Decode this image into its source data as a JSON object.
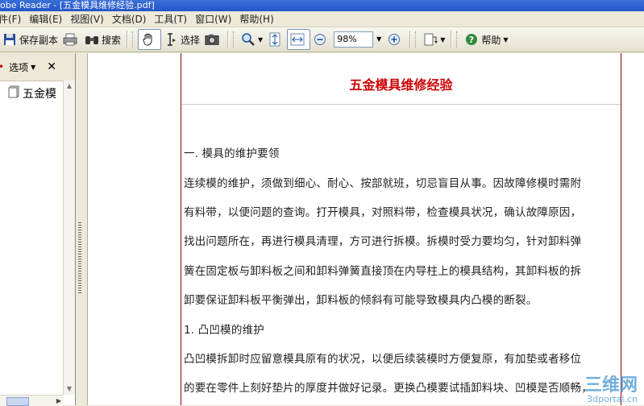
{
  "window": {
    "title": "obe Reader - [五金模具维修经验.pdf]"
  },
  "menu": [
    "件(F)",
    "编辑(E)",
    "视图(V)",
    "文档(D)",
    "工具(T)",
    "窗口(W)",
    "帮助(H)"
  ],
  "toolbar": {
    "save_copy": "保存副本",
    "search": "搜索",
    "select": "选择",
    "zoom": "98%",
    "help": "帮助"
  },
  "left_panel": {
    "options": "选项",
    "bookmark": "五金模"
  },
  "document": {
    "title": "五金模具维修经验",
    "lines": [
      "一.    模具的维护要领",
      "连续模的维护，须做到细心、耐心、按部就班，切忌盲目从事。因故障修模时需附",
      "有料带，以便问题的查询。打开模具，对照料带，检查模具状况，确认故障原因，",
      "找出问题所在，再进行模具清理，方可进行拆模。拆模时受力要均匀，针对卸料弹",
      "簧在固定板与卸料板之间和卸料弹簧直接顶在内导柱上的模具结构，其卸料板的拆",
      "卸要保证卸料板平衡弹出，卸料板的倾斜有可能导致模具内凸模的断裂。",
      "1.   凸凹模的维护",
      "凸凹模拆卸时应留意模具原有的状况，以便后续装模时方便复原，有加垫或者移位",
      "的要在零件上刻好垫片的厚度并做好记录。更换凸模要试插卸料块、凹模是否顺畅，"
    ]
  },
  "watermark": {
    "main": "三维网",
    "sub": "3dportal.cn"
  }
}
